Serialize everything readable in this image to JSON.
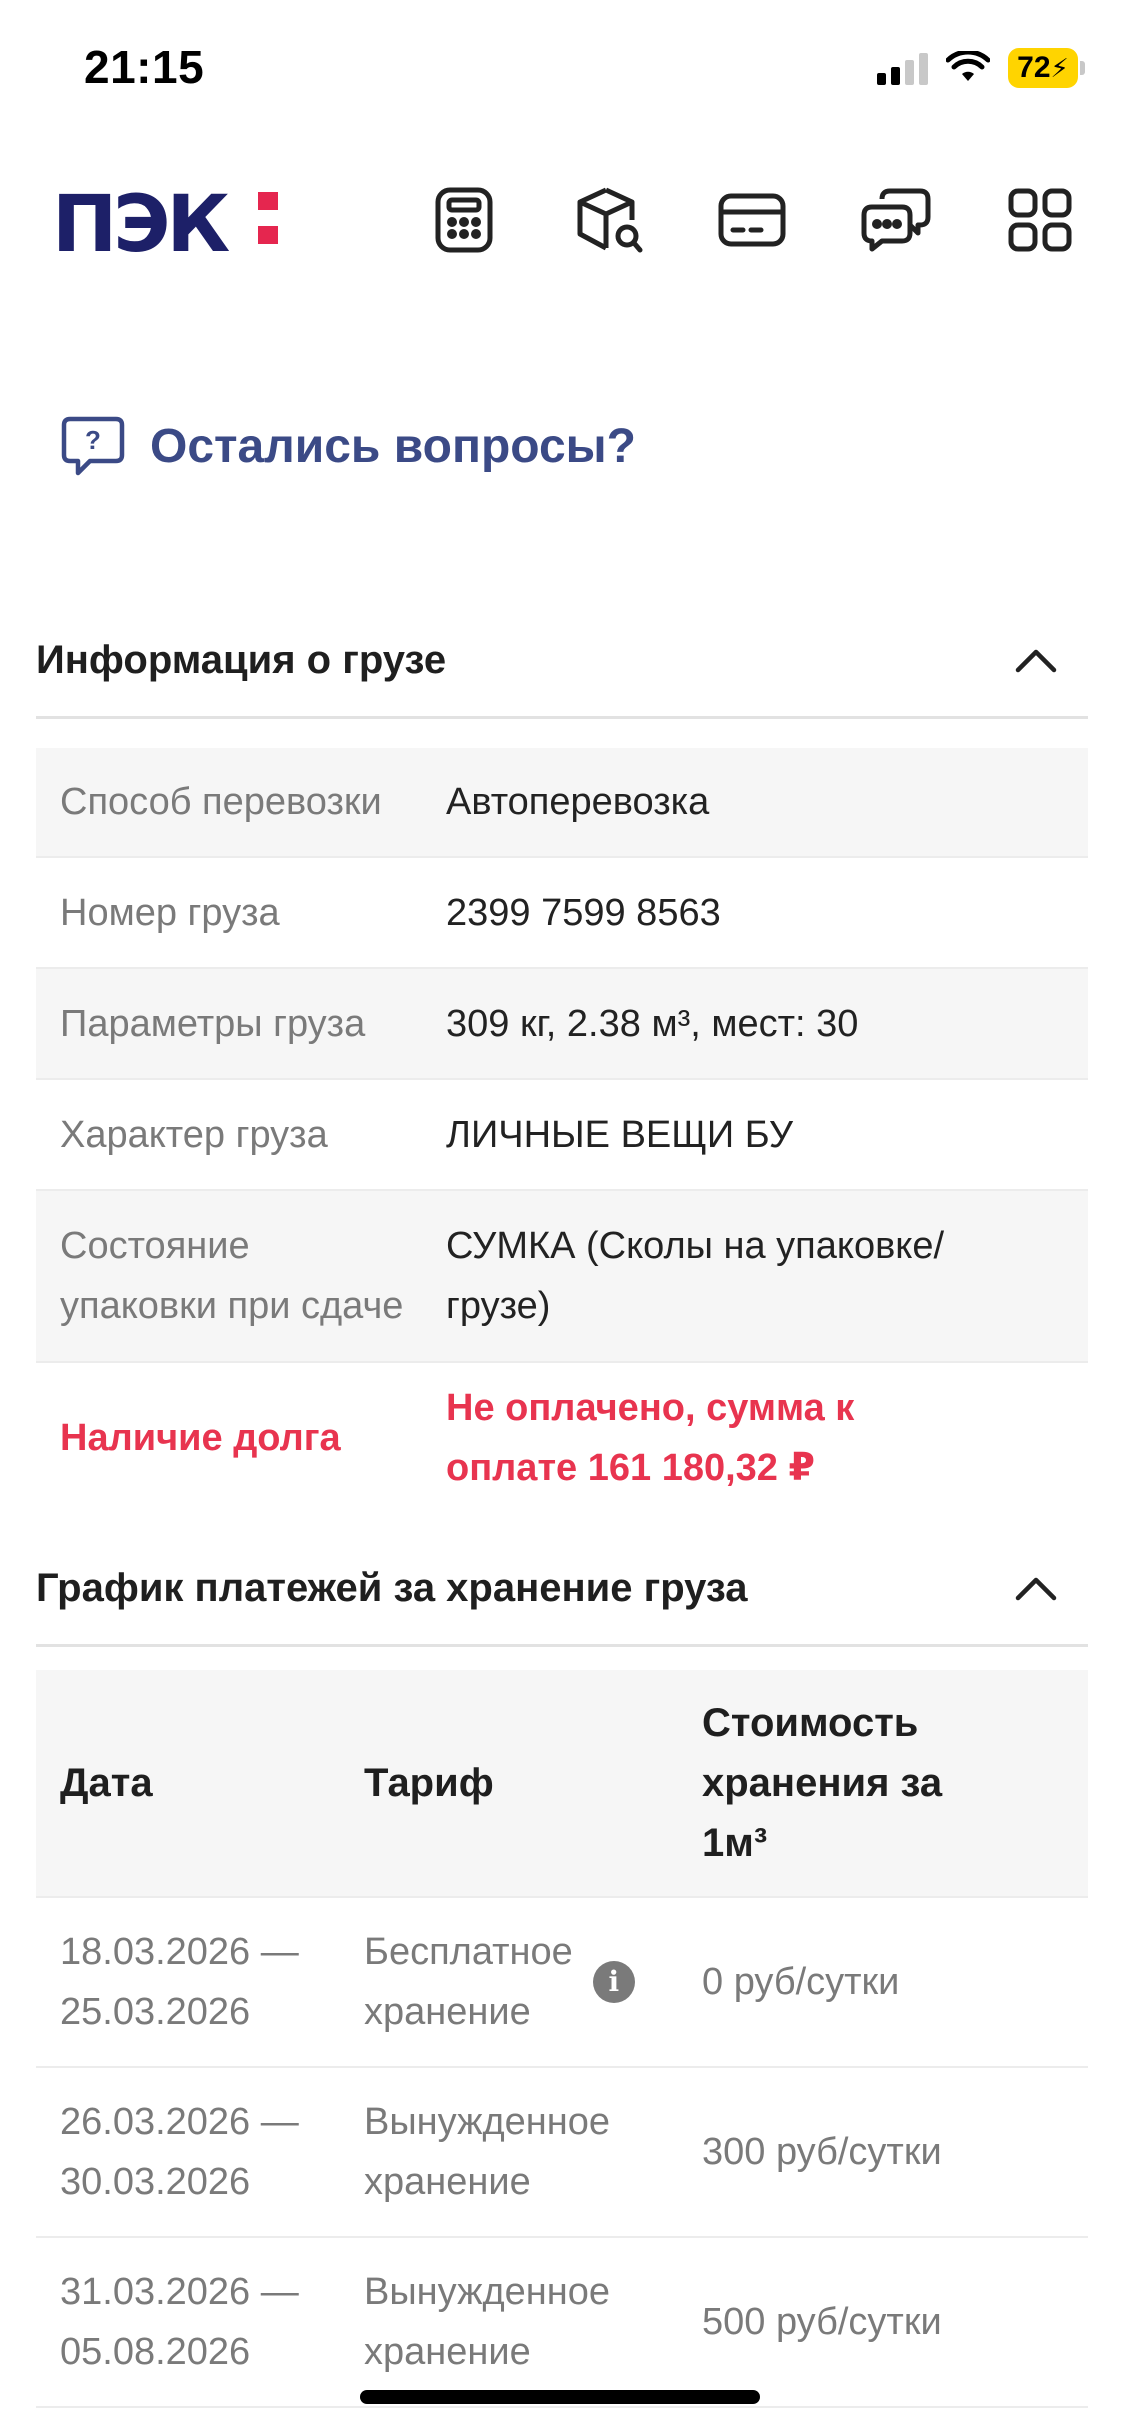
{
  "status_bar": {
    "time": "21:15",
    "battery": "72"
  },
  "header": {
    "logo_text": "ПЭК",
    "icons": [
      "calculator-icon",
      "package-search-icon",
      "card-icon",
      "chat-icon",
      "grid-menu-icon"
    ]
  },
  "questions": {
    "label": "Остались вопросы?"
  },
  "cargo_info": {
    "title": "Информация о грузе",
    "rows": [
      {
        "label": "Способ перевозки",
        "value": "Автоперевозка"
      },
      {
        "label": "Номер груза",
        "value": "2399 7599 8563"
      },
      {
        "label": "Параметры груза",
        "value": "309 кг, 2.38 м³, мест: 30"
      },
      {
        "label": "Характер груза",
        "value": "ЛИЧНЫЕ ВЕЩИ БУ"
      },
      {
        "label_line1": "Состояние",
        "label_line2": "упаковки при сдаче",
        "value_line1": "СУМКА (Сколы на упаковке/",
        "value_line2": "грузе)"
      },
      {
        "label": "Наличие долга",
        "value_line1": "Не оплачено, сумма к",
        "value_line2": "оплате 161 180,32 ₽"
      }
    ]
  },
  "storage_schedule": {
    "title": "График платежей за хранение груза",
    "columns": {
      "date": "Дата",
      "tariff": "Тариф",
      "cost_line1": "Стоимость",
      "cost_line2": "хранения за",
      "cost_line3": "1м³"
    },
    "rows": [
      {
        "date_from": "18.03.2026 —",
        "date_to": "25.03.2026",
        "tariff_line1": "Бесплатное",
        "tariff_line2": "хранение",
        "cost": "0 руб/сутки",
        "has_info": true
      },
      {
        "date_from": "26.03.2026 —",
        "date_to": "30.03.2026",
        "tariff_line1": "Вынужденное",
        "tariff_line2": "хранение",
        "cost": "300 руб/сутки"
      },
      {
        "date_from": "31.03.2026 —",
        "date_to": "05.08.2026",
        "tariff_line1": "Вынужденное",
        "tariff_line2": "хранение",
        "cost": "500 руб/сутки"
      }
    ]
  },
  "colors": {
    "brand_navy": "#1d2068",
    "brand_red": "#e5264f",
    "debt_red": "#e8344f",
    "link_blue": "#3b4a86"
  }
}
